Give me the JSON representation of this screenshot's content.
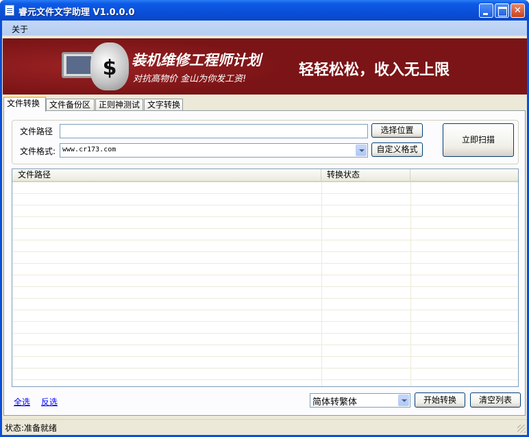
{
  "window": {
    "title": "睿元文件文字助理 V1.0.0.0",
    "titlebar_color": "#0a4fd8"
  },
  "menubar": {
    "items": [
      {
        "label": "关于"
      }
    ]
  },
  "banner": {
    "headline": "装机维修工程师计划",
    "subline": "对抗高物价 金山为你发工资!",
    "slogan": "轻轻松松，收入无上限",
    "background": "#7b1416",
    "icons": [
      "money-bag-icon",
      "computer-monitor-icon"
    ]
  },
  "tabs": [
    {
      "label": "文件转换",
      "active": true
    },
    {
      "label": "文件备份区",
      "active": false
    },
    {
      "label": "正则神测试",
      "active": false
    },
    {
      "label": "文字转换",
      "active": false
    }
  ],
  "form": {
    "path_label": "文件路径",
    "path_value": "",
    "format_label": "文件格式:",
    "format_value": "www.cr173.com",
    "choose_location_label": "选择位置",
    "custom_format_label": "自定义格式",
    "scan_now_label": "立即扫描"
  },
  "listview": {
    "columns": [
      "文件路径",
      "转换状态",
      ""
    ],
    "rows": []
  },
  "footer": {
    "select_all_label": "全选",
    "invert_selection_label": "反选",
    "conversion_mode": "简体转繁体",
    "start_convert_label": "开始转换",
    "clear_list_label": "清空列表"
  },
  "status": {
    "text": "状态:准备就绪"
  }
}
